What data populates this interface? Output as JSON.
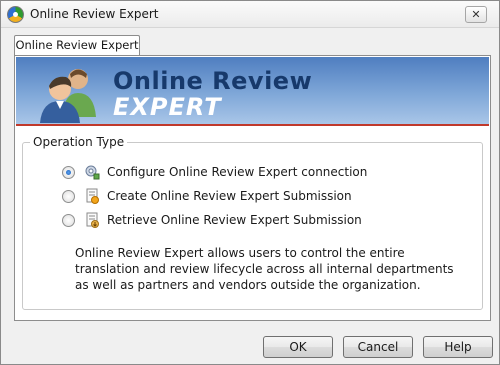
{
  "window": {
    "title": "Online Review Expert",
    "close_symbol": "✕"
  },
  "tab": {
    "label": "Online Review Expert"
  },
  "banner": {
    "line1": "Online Review",
    "line2": "EXPERT"
  },
  "operation": {
    "group_title": "Operation Type",
    "options": [
      {
        "label": "Configure Online Review Expert connection",
        "checked": true,
        "icon": "connection-config-icon"
      },
      {
        "label": "Create Online Review Expert Submission",
        "checked": false,
        "icon": "create-submission-icon"
      },
      {
        "label": "Retrieve Online Review Expert Submission",
        "checked": false,
        "icon": "retrieve-submission-icon"
      }
    ],
    "description": "Online Review Expert allows users to control the entire translation and review lifecycle across all internal departments as well as partners and vendors outside the organization."
  },
  "buttons": {
    "ok": "OK",
    "cancel": "Cancel",
    "help": "Help"
  },
  "colors": {
    "banner_top": "#4f7ec0",
    "banner_bottom": "#a9c6e8",
    "banner_title": "#17396b",
    "accent_line": "#c0392b"
  }
}
